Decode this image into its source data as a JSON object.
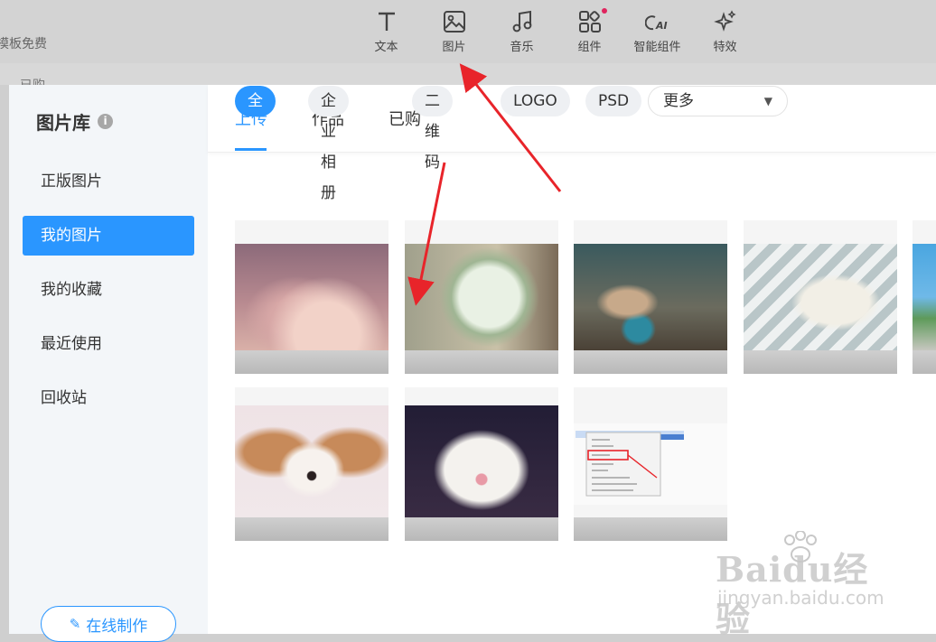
{
  "background": {
    "left_text": "模板免费",
    "left_text2": "已购"
  },
  "toolbar": {
    "items": [
      {
        "label": "文本",
        "icon": "text-icon"
      },
      {
        "label": "图片",
        "icon": "image-icon"
      },
      {
        "label": "音乐",
        "icon": "music-icon"
      },
      {
        "label": "组件",
        "icon": "components-icon"
      },
      {
        "label": "智能组件",
        "icon": "ai-icon",
        "ai_text": "AI"
      },
      {
        "label": "特效",
        "icon": "sparkle-icon"
      }
    ]
  },
  "sidebar": {
    "title": "图片库",
    "items": [
      {
        "label": "正版图片",
        "active": false
      },
      {
        "label": "我的图片",
        "active": true
      },
      {
        "label": "我的收藏",
        "active": false
      },
      {
        "label": "最近使用",
        "active": false
      },
      {
        "label": "回收站",
        "active": false
      }
    ],
    "online_button": "在线制作"
  },
  "tabs": [
    {
      "label": "上传",
      "active": true
    },
    {
      "label": "作品",
      "active": false
    },
    {
      "label": "已购",
      "active": false
    }
  ],
  "filters": {
    "chips": [
      {
        "label": "全部",
        "active": true
      },
      {
        "label": "企业相册",
        "active": false
      },
      {
        "label": "二维码",
        "active": false
      },
      {
        "label": "LOGO",
        "active": false
      },
      {
        "label": "PSD",
        "active": false
      }
    ],
    "more_select": "更多"
  },
  "images": [
    {
      "name": "pink-clouds"
    },
    {
      "name": "mint-drink"
    },
    {
      "name": "cat-with-cup"
    },
    {
      "name": "open-book-glasses"
    },
    {
      "name": "tree-sky"
    },
    {
      "name": "puppy"
    },
    {
      "name": "white-kitten"
    },
    {
      "name": "context-menu-screenshot"
    }
  ],
  "watermark": {
    "main": "Baidu经验",
    "sub": "jingyan.baidu.com"
  },
  "colors": {
    "accent": "#2a96ff",
    "annotation": "#e8242a"
  }
}
